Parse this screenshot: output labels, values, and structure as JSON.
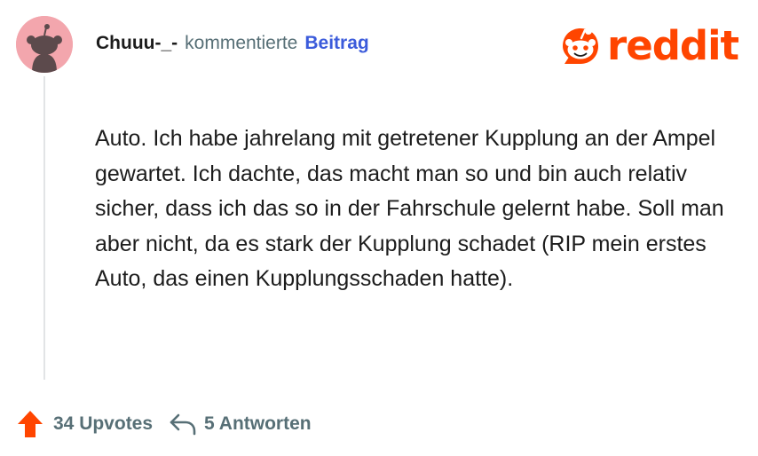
{
  "comment": {
    "username": "Chuuu-_-",
    "action_text": "kommentierte",
    "post_link": "Beitrag",
    "body": "Auto. Ich habe jahrelang mit getretener Kupplung an der Ampel gewartet. Ich dachte, das macht man so und bin auch relativ sicher, dass ich das so in der Fahrschule gelernt habe. Soll man aber nicht, da es stark der Kupplung schadet (RIP mein erstes Auto, das einen Kupplungsschaden hatte)."
  },
  "footer": {
    "upvotes_label": "34 Upvotes",
    "replies_label": "5 Antworten"
  },
  "brand": {
    "logo_text": "reddit",
    "accent_color": "#ff4500",
    "avatar_background": "#f3a6ad",
    "link_color": "#3b5bdb"
  },
  "icons": {
    "avatar": "snoo-avatar-icon",
    "logo": "reddit-logo-icon",
    "upvote": "upvote-arrow-icon",
    "reply": "reply-arrow-icon"
  }
}
